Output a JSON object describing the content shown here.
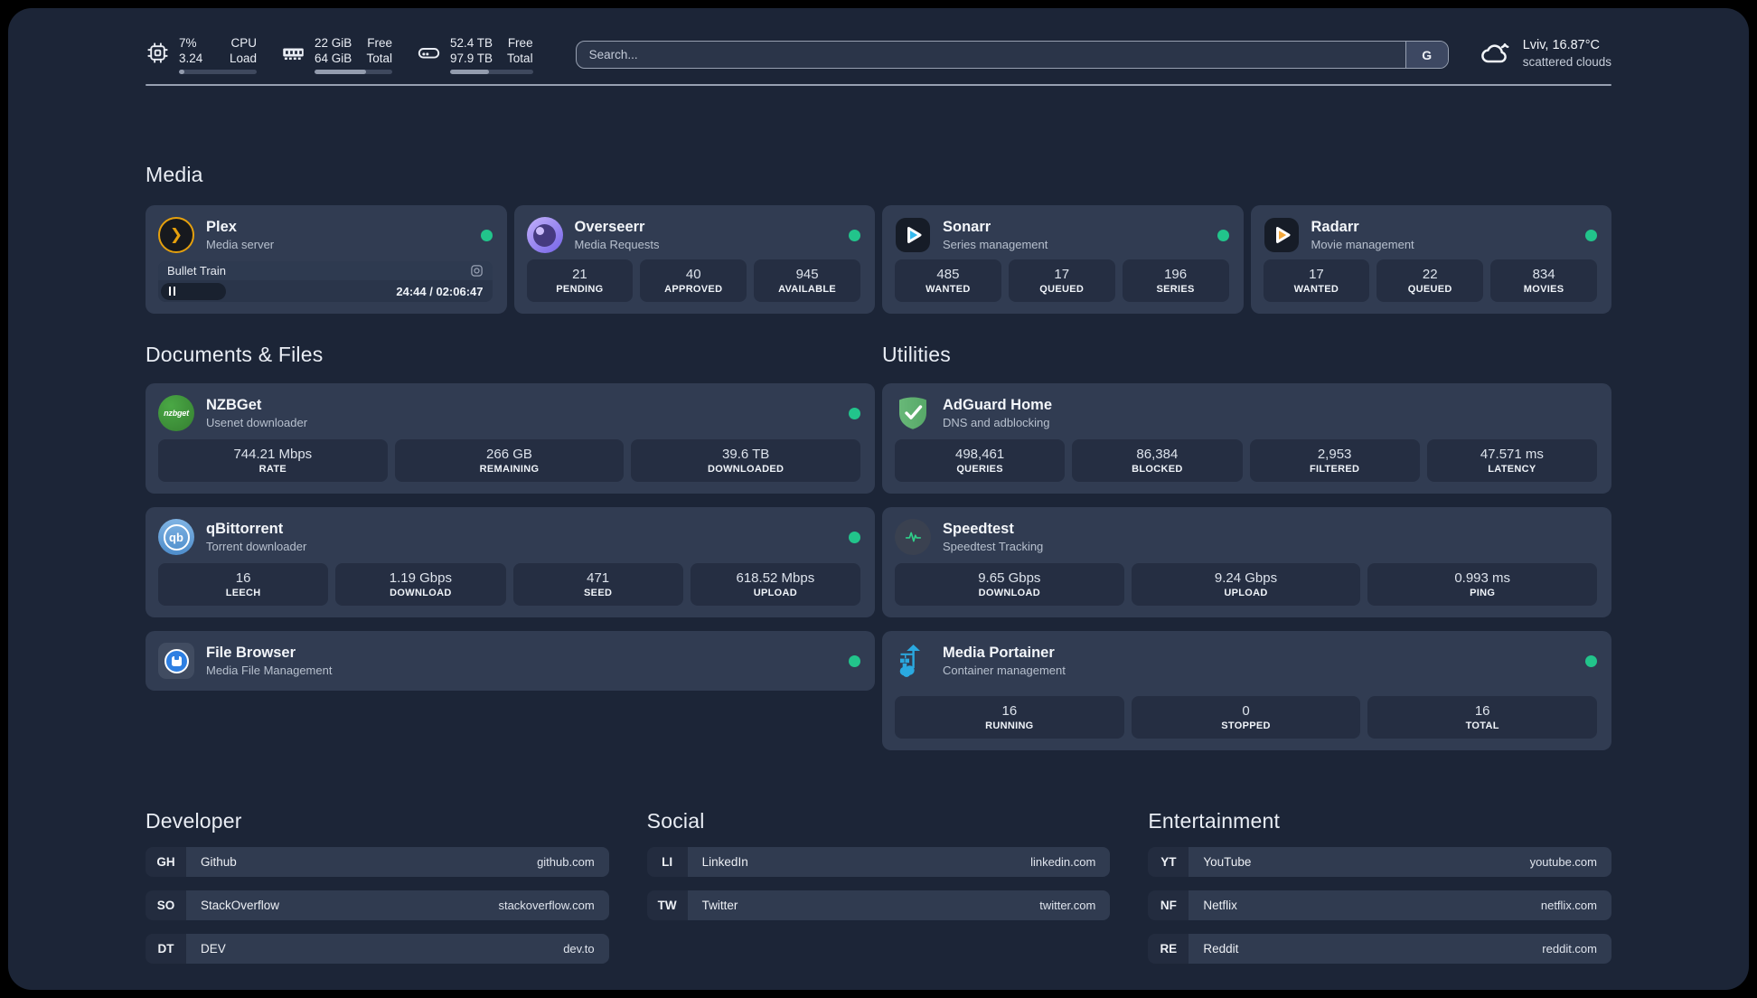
{
  "header": {
    "system": {
      "cpu": {
        "values": [
          "7%",
          "3.24"
        ],
        "labels": [
          "CPU",
          "Load"
        ],
        "percent": 7
      },
      "memory": {
        "values": [
          "22 GiB",
          "64 GiB"
        ],
        "labels": [
          "Free",
          "Total"
        ],
        "percent": 66
      },
      "storage": {
        "values": [
          "52.4 TB",
          "97.9 TB"
        ],
        "labels": [
          "Free",
          "Total"
        ],
        "percent": 47
      }
    },
    "search": {
      "placeholder": "Search...",
      "engine_button": "G"
    },
    "weather": {
      "location_temp": "Lviv, 16.87°C",
      "condition": "scattered clouds"
    }
  },
  "sections": {
    "media": {
      "title": "Media"
    },
    "documents": {
      "title": "Documents & Files"
    },
    "utilities": {
      "title": "Utilities"
    },
    "developer": {
      "title": "Developer"
    },
    "social": {
      "title": "Social"
    },
    "entertainment": {
      "title": "Entertainment"
    }
  },
  "services": {
    "plex": {
      "name": "Plex",
      "desc": "Media server",
      "online": true,
      "icon_glyph": "❯",
      "player": {
        "title": "Bullet Train",
        "time": "24:44 / 02:06:47",
        "progress_percent": 19.5
      }
    },
    "overseerr": {
      "name": "Overseerr",
      "desc": "Media Requests",
      "online": true,
      "stats": [
        {
          "value": "21",
          "label": "PENDING"
        },
        {
          "value": "40",
          "label": "APPROVED"
        },
        {
          "value": "945",
          "label": "AVAILABLE"
        }
      ]
    },
    "sonarr": {
      "name": "Sonarr",
      "desc": "Series management",
      "online": true,
      "stats": [
        {
          "value": "485",
          "label": "WANTED"
        },
        {
          "value": "17",
          "label": "QUEUED"
        },
        {
          "value": "196",
          "label": "SERIES"
        }
      ]
    },
    "radarr": {
      "name": "Radarr",
      "desc": "Movie management",
      "online": true,
      "stats": [
        {
          "value": "17",
          "label": "WANTED"
        },
        {
          "value": "22",
          "label": "QUEUED"
        },
        {
          "value": "834",
          "label": "MOVIES"
        }
      ]
    },
    "nzbget": {
      "name": "NZBGet",
      "desc": "Usenet downloader",
      "online": true,
      "icon_text": "nzbget",
      "stats": [
        {
          "value": "744.21 Mbps",
          "label": "RATE"
        },
        {
          "value": "266 GB",
          "label": "REMAINING"
        },
        {
          "value": "39.6 TB",
          "label": "DOWNLOADED"
        }
      ]
    },
    "qbittorrent": {
      "name": "qBittorrent",
      "desc": "Torrent downloader",
      "online": true,
      "icon_text": "qb",
      "stats": [
        {
          "value": "16",
          "label": "LEECH"
        },
        {
          "value": "1.19 Gbps",
          "label": "DOWNLOAD"
        },
        {
          "value": "471",
          "label": "SEED"
        },
        {
          "value": "618.52 Mbps",
          "label": "UPLOAD"
        }
      ]
    },
    "filebrowser": {
      "name": "File Browser",
      "desc": "Media File Management",
      "online": true
    },
    "adguard": {
      "name": "AdGuard Home",
      "desc": "DNS and adblocking",
      "stats": [
        {
          "value": "498,461",
          "label": "QUERIES"
        },
        {
          "value": "86,384",
          "label": "BLOCKED"
        },
        {
          "value": "2,953",
          "label": "FILTERED"
        },
        {
          "value": "47.571 ms",
          "label": "LATENCY"
        }
      ]
    },
    "speedtest": {
      "name": "Speedtest",
      "desc": "Speedtest Tracking",
      "stats": [
        {
          "value": "9.65 Gbps",
          "label": "DOWNLOAD"
        },
        {
          "value": "9.24 Gbps",
          "label": "UPLOAD"
        },
        {
          "value": "0.993 ms",
          "label": "PING"
        }
      ]
    },
    "portainer": {
      "name": "Media Portainer",
      "desc": "Container management",
      "online": true,
      "stats": [
        {
          "value": "16",
          "label": "RUNNING"
        },
        {
          "value": "0",
          "label": "STOPPED"
        },
        {
          "value": "16",
          "label": "TOTAL"
        }
      ]
    }
  },
  "bookmarks": {
    "developer": [
      {
        "abbr": "GH",
        "name": "Github",
        "url": "github.com"
      },
      {
        "abbr": "SO",
        "name": "StackOverflow",
        "url": "stackoverflow.com"
      },
      {
        "abbr": "DT",
        "name": "DEV",
        "url": "dev.to"
      }
    ],
    "social": [
      {
        "abbr": "LI",
        "name": "LinkedIn",
        "url": "linkedin.com"
      },
      {
        "abbr": "TW",
        "name": "Twitter",
        "url": "twitter.com"
      }
    ],
    "entertainment": [
      {
        "abbr": "YT",
        "name": "YouTube",
        "url": "youtube.com"
      },
      {
        "abbr": "NF",
        "name": "Netflix",
        "url": "netflix.com"
      },
      {
        "abbr": "RE",
        "name": "Reddit",
        "url": "reddit.com"
      }
    ]
  },
  "colors": {
    "status-online": "#22c48b",
    "plex-accent": "#e5a00d",
    "sonarr-accent": "#35b9ee",
    "radarr-accent": "#f2a73b",
    "nzbget-accent": "#3d9c39",
    "qbittorrent-accent": "#5d9cd8",
    "adguard-accent": "#63b574",
    "speedtest-accent": "#2fd08a",
    "portainer-accent": "#2aa9e0",
    "filebrowser-accent": "#2e7fe2"
  }
}
